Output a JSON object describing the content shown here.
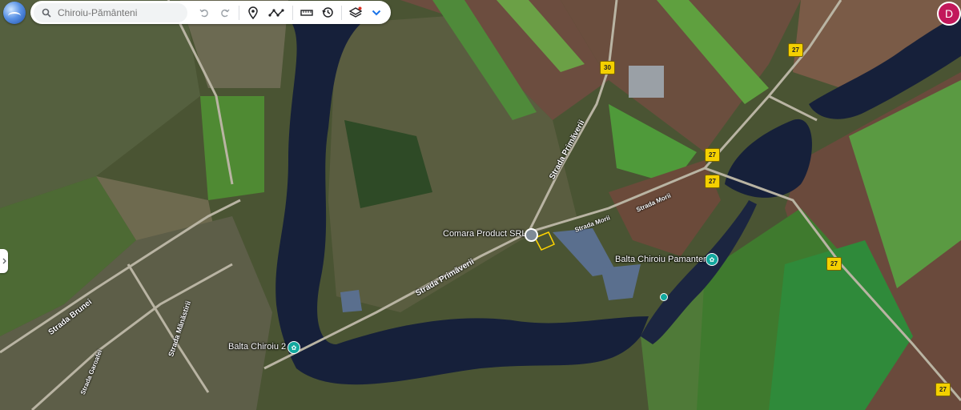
{
  "toolbar": {
    "search_placeholder": "Chiroiu-Pământeni",
    "icons": [
      "search-icon",
      "undo-icon",
      "redo-icon",
      "place-pin-icon",
      "path-icon",
      "ruler-icon",
      "history-icon",
      "layers-icon",
      "chevron-down-icon"
    ]
  },
  "user": {
    "initial": "D",
    "color": "#c2185b"
  },
  "places": {
    "comara": "Comara Product SRL",
    "balta_pamanteni": "Balta Chiroiu Pamanteni",
    "balta_2": "Balta Chiroiu 2"
  },
  "streets": {
    "primaverii_1": "Strada Primăverii",
    "primaverii_2": "Strada Primăverii",
    "morii_1": "Strada Morii",
    "morii_2": "Strada Morii",
    "brunei": "Strada Brunei",
    "manastirii": "Strada Mănăstirii",
    "garoafei": "Strada Garoafei"
  },
  "road_shields": {
    "r30": "30",
    "r27_a": "27",
    "r27_b": "27",
    "r27_c": "27",
    "r27_d": "27",
    "r27_e": "27"
  },
  "colors": {
    "shield": "#f4d000",
    "water": "#16203a",
    "place_pin": "#13a89e"
  }
}
